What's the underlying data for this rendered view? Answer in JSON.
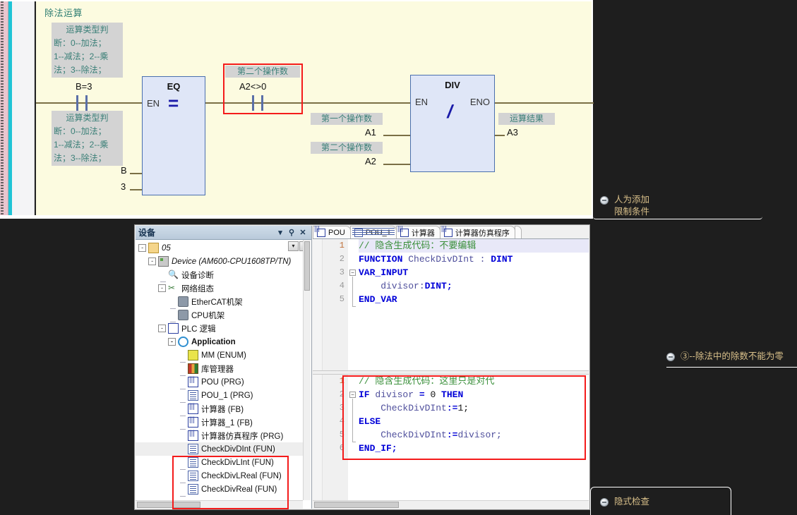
{
  "ladder": {
    "title": "除法运算",
    "comment_block_text": "运算类型判\n断：0--加法；\n1--减法；2--乘\n法；3--除法；",
    "comment_lines": [
      "运算类型判",
      "断：0--加法；",
      "1--减法；2--乘",
      "法；3--除法；"
    ],
    "contact1_label": "B=3",
    "eq_block": {
      "name": "EQ",
      "en": "EN",
      "glyph": "=",
      "in1": "B",
      "in2": "3"
    },
    "contact2_comment": "第二个操作数",
    "contact2_label": "A2<>0",
    "div_block": {
      "name": "DIV",
      "en": "EN",
      "eno": "ENO",
      "glyph": "/"
    },
    "div_in1_comment": "第一个操作数",
    "div_in1": "A1",
    "div_in2_comment": "第二个操作数",
    "div_in2": "A2",
    "div_out_comment": "运算结果",
    "div_out": "A3"
  },
  "device_panel": {
    "title": "设备",
    "header_icons": [
      "chevron-down-icon",
      "pin-icon",
      "close-icon"
    ],
    "toolbar_icons": [
      "dropdown-icon",
      "collapse-icon"
    ],
    "tree": [
      {
        "label": "05",
        "depth": 0,
        "icon": "project-icon",
        "expander": "-",
        "style": "ital"
      },
      {
        "label": "Device (AM600-CPU1608TP/TN)",
        "depth": 1,
        "icon": "device-icon",
        "expander": "-",
        "style": "ital"
      },
      {
        "label": "设备诊断",
        "depth": 2,
        "icon": "diagnostics-icon",
        "expander": "",
        "style": ""
      },
      {
        "label": "网络组态",
        "depth": 2,
        "icon": "network-icon",
        "expander": "-",
        "style": ""
      },
      {
        "label": "EtherCAT机架",
        "depth": 3,
        "icon": "rack-icon",
        "expander": "",
        "style": ""
      },
      {
        "label": "CPU机架",
        "depth": 3,
        "icon": "rack-icon",
        "expander": "",
        "style": ""
      },
      {
        "label": "PLC 逻辑",
        "depth": 2,
        "icon": "plc-logic-icon",
        "expander": "-",
        "style": ""
      },
      {
        "label": "Application",
        "depth": 3,
        "icon": "application-icon",
        "expander": "-",
        "style": "bold"
      },
      {
        "label": "MM (ENUM)",
        "depth": 4,
        "icon": "enum-icon",
        "expander": "",
        "style": ""
      },
      {
        "label": "库管理器",
        "depth": 4,
        "icon": "library-manager-icon",
        "expander": "",
        "style": ""
      },
      {
        "label": "POU (PRG)",
        "depth": 4,
        "icon": "prg-icon",
        "expander": "",
        "style": ""
      },
      {
        "label": "POU_1 (PRG)",
        "depth": 4,
        "icon": "doc-icon",
        "expander": "",
        "style": ""
      },
      {
        "label": "计算器 (FB)",
        "depth": 4,
        "icon": "prg-icon",
        "expander": "",
        "style": ""
      },
      {
        "label": "计算器_1 (FB)",
        "depth": 4,
        "icon": "prg-icon",
        "expander": "",
        "style": ""
      },
      {
        "label": "计算器仿真程序 (PRG)",
        "depth": 4,
        "icon": "prg-icon",
        "expander": "",
        "style": ""
      },
      {
        "label": "CheckDivDInt (FUN)",
        "depth": 4,
        "icon": "doc-icon",
        "expander": "",
        "style": "sel"
      },
      {
        "label": "CheckDivLInt (FUN)",
        "depth": 4,
        "icon": "doc-icon",
        "expander": "",
        "style": ""
      },
      {
        "label": "CheckDivLReal (FUN)",
        "depth": 4,
        "icon": "doc-icon",
        "expander": "",
        "style": ""
      },
      {
        "label": "CheckDivReal (FUN)",
        "depth": 4,
        "icon": "doc-icon",
        "expander": "",
        "style": ""
      }
    ]
  },
  "editor": {
    "tabs": [
      {
        "label": "POU",
        "icon": "prg-icon"
      },
      {
        "label": "POU_1",
        "icon": "doc-icon"
      },
      {
        "label": "计算器",
        "icon": "prg-icon"
      },
      {
        "label": "计算器仿真程序",
        "icon": "prg-icon"
      },
      {
        "label": "",
        "icon": ""
      }
    ],
    "top_pane": {
      "lines": [
        {
          "n": "1",
          "segments": [
            {
              "t": "// 隐含生成代码：不要编辑",
              "c": "cm"
            }
          ]
        },
        {
          "n": "2",
          "segments": [
            {
              "t": "FUNCTION ",
              "c": "kw"
            },
            {
              "t": "CheckDivDInt : ",
              "c": "id"
            },
            {
              "t": "DINT",
              "c": "kw"
            }
          ]
        },
        {
          "n": "3",
          "segments": [
            {
              "t": "VAR_INPUT",
              "c": "kw"
            }
          ]
        },
        {
          "n": "4",
          "segments": [
            {
              "t": "    divisor:",
              "c": "id"
            },
            {
              "t": "DINT;",
              "c": "kw"
            }
          ]
        },
        {
          "n": "5",
          "segments": [
            {
              "t": "END_VAR",
              "c": "kw"
            }
          ]
        }
      ]
    },
    "bottom_pane": {
      "lines": [
        {
          "n": "1",
          "segments": [
            {
              "t": "// 隐含生成代码：这里只是对代",
              "c": "cm"
            }
          ]
        },
        {
          "n": "2",
          "segments": [
            {
              "t": "IF ",
              "c": "kw"
            },
            {
              "t": "divisor ",
              "c": "id"
            },
            {
              "t": "= ",
              "c": "kw"
            },
            {
              "t": "0 ",
              "c": "lit"
            },
            {
              "t": "THEN",
              "c": "kw"
            }
          ]
        },
        {
          "n": "3",
          "segments": [
            {
              "t": "    CheckDivDInt",
              "c": "id"
            },
            {
              "t": ":=",
              "c": "kw"
            },
            {
              "t": "1;",
              "c": "lit"
            }
          ]
        },
        {
          "n": "4",
          "segments": [
            {
              "t": "ELSE",
              "c": "kw"
            }
          ]
        },
        {
          "n": "5",
          "segments": [
            {
              "t": "    CheckDivDInt",
              "c": "id"
            },
            {
              "t": ":=",
              "c": "kw"
            },
            {
              "t": "divisor;",
              "c": "id"
            }
          ]
        },
        {
          "n": "6",
          "segments": [
            {
              "t": "END_IF;",
              "c": "kw"
            }
          ]
        }
      ]
    }
  },
  "annotations": [
    {
      "id": "anno-manual-limit",
      "lines": [
        "人为添加",
        "限制条件"
      ]
    },
    {
      "id": "anno-divisor-nonzero",
      "lines": [
        "③--除法中的除数不能为零"
      ]
    },
    {
      "id": "anno-implicit-check",
      "lines": [
        "隐式检查"
      ]
    }
  ],
  "colors": {
    "highlight_red": "#f41b1b",
    "ladder_bg": "#fcfbe0",
    "block_fill": "#dfe6f7",
    "block_border": "#4a6fae",
    "comment_bg": "#d3d3d3",
    "comment_fg": "#3a7f77",
    "annotation_fg": "#d9c08a",
    "keyword": "#0000d8",
    "code_comment": "#3a8f3a"
  }
}
